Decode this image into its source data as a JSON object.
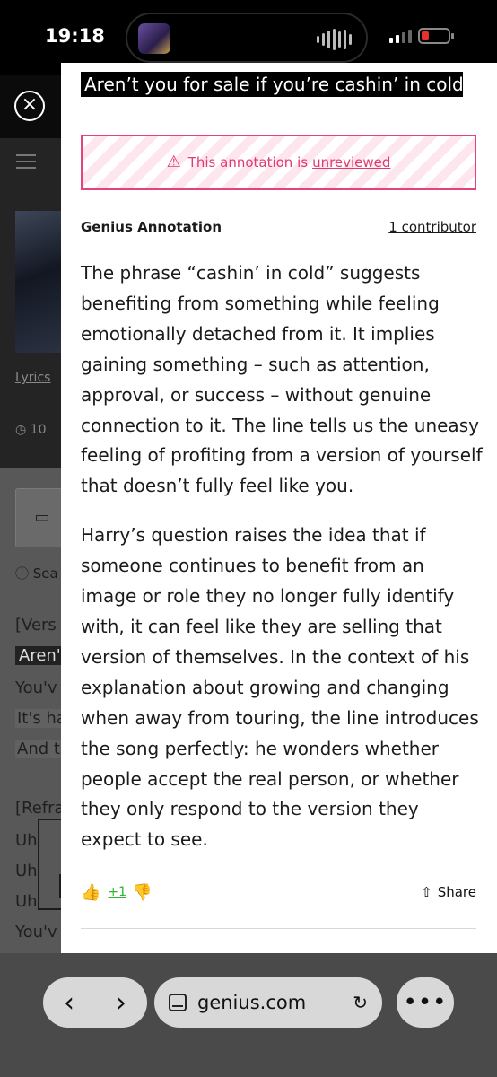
{
  "status_bar": {
    "time": "19:18"
  },
  "background_page": {
    "lyrics_link": "Lyrics",
    "views": "10",
    "search_hint": "Sea",
    "lyric_lines": [
      "[Vers",
      "Aren't",
      "You'v",
      "It's ha",
      "And t",
      "[Refra",
      "Uh",
      "Uh",
      "Uh",
      "You'v"
    ]
  },
  "annotation": {
    "quote": "Aren’t you for sale if you’re cashin’ in cold?",
    "banner_prefix": "This annotation is",
    "banner_link": "unreviewed",
    "label": "Genius Annotation",
    "contributors": "1 contributor",
    "paragraphs": [
      "The phrase “cashin’ in cold” suggests benefiting from something while feeling emotionally detached from it. It implies gaining something – such as attention, approval, or success – without genuine connection to it. The line tells us the uneasy feeling of profiting from a version of yourself that doesn’t fully feel like you.",
      "Harry’s question raises the idea that if someone continues to benefit from an image or role they no longer fully identify with, it can feel like they are selling that version of themselves. In the context of his explanation about growing and changing when away from touring, the line introduces the song perfectly: he wonders whether people accept the real person, or whether they only respond to the version they expect to see."
    ],
    "votes": "+1",
    "share": "Share"
  },
  "browser": {
    "url": "genius.com"
  },
  "colors": {
    "accent_pink": "#e23a6e",
    "vote_green": "#2fb52f"
  }
}
